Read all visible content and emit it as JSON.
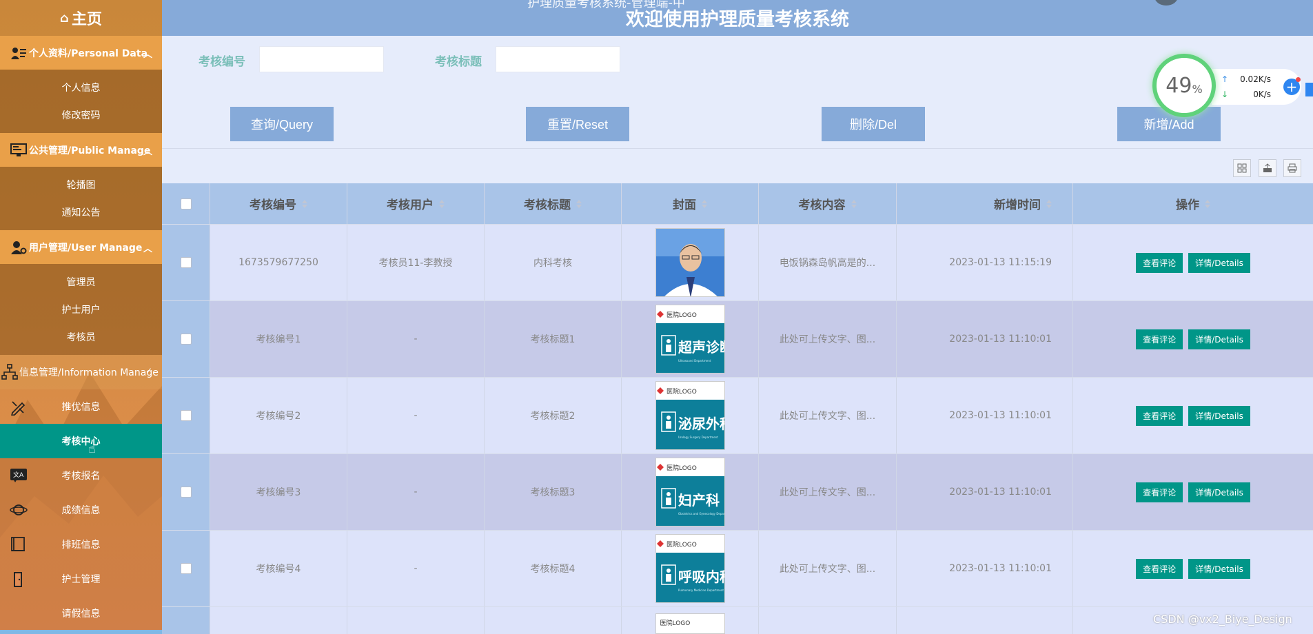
{
  "sidebar": {
    "home": "主页",
    "personal": {
      "label": "个人资料/Personal Data",
      "items": [
        "个人信息",
        "修改密码"
      ]
    },
    "public": {
      "label": "公共管理/Public Manage",
      "items": [
        "轮播图",
        "通知公告"
      ]
    },
    "users": {
      "label": "用户管理/User Manage",
      "items": [
        "管理员",
        "护士用户",
        "考核员"
      ]
    },
    "info": {
      "label": "信息管理/Information Manage",
      "items": [
        "推优信息",
        "考核中心",
        "考核报名",
        "成绩信息",
        "排班信息",
        "护士管理",
        "请假信息"
      ]
    }
  },
  "header": {
    "title": "欢迎使用护理质量考核系统",
    "ghost": "护理质量考核系统-管理端-中"
  },
  "search": {
    "label1": "考核编号",
    "label2": "考核标题",
    "value1": "",
    "value2": ""
  },
  "buttons": {
    "query": "查询/Query",
    "reset": "重置/Reset",
    "delete": "删除/Del",
    "add": "新增/Add"
  },
  "table": {
    "headers": [
      "考核编号",
      "考核用户",
      "考核标题",
      "封面",
      "考核内容",
      "新增时间",
      "操作"
    ],
    "rows": [
      {
        "id": "1673579677250",
        "user": "考核员11-李教授",
        "title": "内科考核",
        "cover": "portrait",
        "content": "电饭锅森岛帆高是的...",
        "time": "2023-01-13 11:15:19"
      },
      {
        "id": "考核编号1",
        "user": "-",
        "title": "考核标题1",
        "cover": "超声诊断科",
        "cover_en": "Ultrasound Department",
        "content": "此处可上传文字、图...",
        "time": "2023-01-13 11:10:01"
      },
      {
        "id": "考核编号2",
        "user": "-",
        "title": "考核标题2",
        "cover": "泌尿外科",
        "cover_en": "Urology Surgery Department",
        "content": "此处可上传文字、图...",
        "time": "2023-01-13 11:10:01"
      },
      {
        "id": "考核编号3",
        "user": "-",
        "title": "考核标题3",
        "cover": "妇产科",
        "cover_en": "Obstetrics and Gynecology Department",
        "content": "此处可上传文字、图...",
        "time": "2023-01-13 11:10:01"
      },
      {
        "id": "考核编号4",
        "user": "-",
        "title": "考核标题4",
        "cover": "呼吸内科",
        "cover_en": "Pulmonary Medicine Department",
        "content": "此处可上传文字、图...",
        "time": "2023-01-13 11:10:01"
      }
    ],
    "action_review": "查看评论",
    "action_details": "详情/Details",
    "cover_logo": "医院LOGO"
  },
  "widget": {
    "percent": "49",
    "percent_unit": "%",
    "upload": "0.02K/s",
    "download": "0K/s"
  },
  "watermark": "CSDN @vx2_Biye_Design",
  "colors": {
    "sidebar": "#d08b3f",
    "group": "#e9a049",
    "active": "#009688",
    "header": "#86aad9",
    "button": "#86aad9"
  }
}
